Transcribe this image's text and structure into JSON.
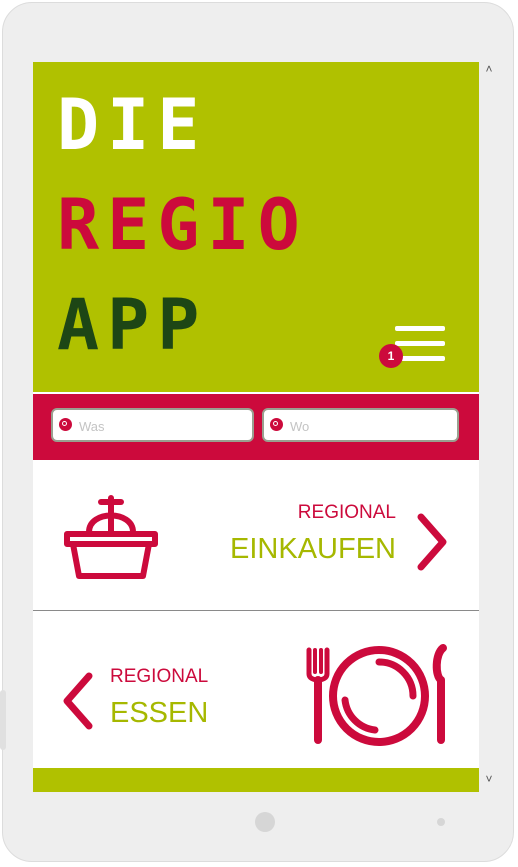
{
  "logo": {
    "line1": "DIE",
    "line2": "REGIO",
    "line3": "APP"
  },
  "menu": {
    "badge_count": "1",
    "icon": "hamburger-menu-icon"
  },
  "search": {
    "was_placeholder": "Was",
    "wo_placeholder": "Wo",
    "icon": "search-icon"
  },
  "tiles": {
    "einkaufen": {
      "small": "REGIONAL",
      "big": "EINKAUFEN",
      "icon": "shopping-basket-icon",
      "arrow": "chevron-right-icon"
    },
    "essen": {
      "small": "REGIONAL",
      "big": "ESSEN",
      "icon": "plate-fork-knife-icon",
      "arrow": "chevron-left-icon"
    }
  },
  "scroll": {
    "up": "˄",
    "down": "˅"
  },
  "colors": {
    "lime": "#b0c100",
    "red": "#cc0a3c",
    "dark_green": "#1d4615",
    "text_lime": "#a6b800"
  }
}
